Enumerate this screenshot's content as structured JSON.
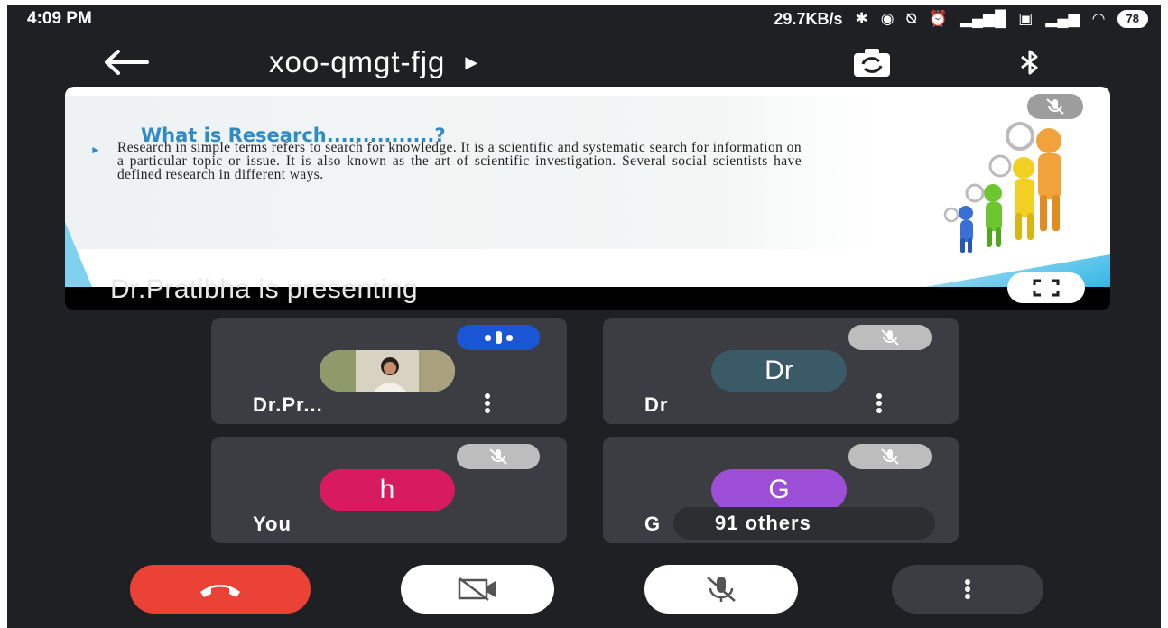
{
  "status_bar": {
    "time": "4:09 PM",
    "network_speed": "29.7KB/s",
    "battery": "78"
  },
  "top_bar": {
    "meeting_code": "xoo-qmgt-fjg"
  },
  "presentation": {
    "slide_title": "What is Research...............?",
    "slide_body": "Research in simple terms refers to search for knowledge. It is a scientific and systematic search for information on a particular topic or issue. It is also known as the art of scientific investigation. Several social scientists have defined research in different ways.",
    "presenting_label": "Dr.Pratibha is presenting"
  },
  "participants": [
    {
      "name": "Dr.Pr...",
      "avatar_letter": "",
      "avatar_color": "#c9c9c9",
      "status": "speaking"
    },
    {
      "name": "Dr",
      "avatar_letter": "Dr",
      "avatar_color": "#3b5a68",
      "status": "muted"
    },
    {
      "name": "You",
      "avatar_letter": "h",
      "avatar_color": "#d81b60",
      "status": "muted"
    },
    {
      "name": "G",
      "avatar_letter": "G",
      "avatar_color": "#9c4fd6",
      "status": "muted",
      "others_label": "91 others"
    }
  ],
  "controls": {
    "hangup_icon": "phone-hangup-icon",
    "camera_icon": "camera-off-icon",
    "mic_icon": "mic-off-icon",
    "more_icon": "more-vertical-icon"
  },
  "colors": {
    "background": "#1f2024",
    "tile": "#3c3d42",
    "hangup": "#ea4335",
    "speaking": "#1a56d6",
    "slide_title": "#2e8bc6"
  }
}
